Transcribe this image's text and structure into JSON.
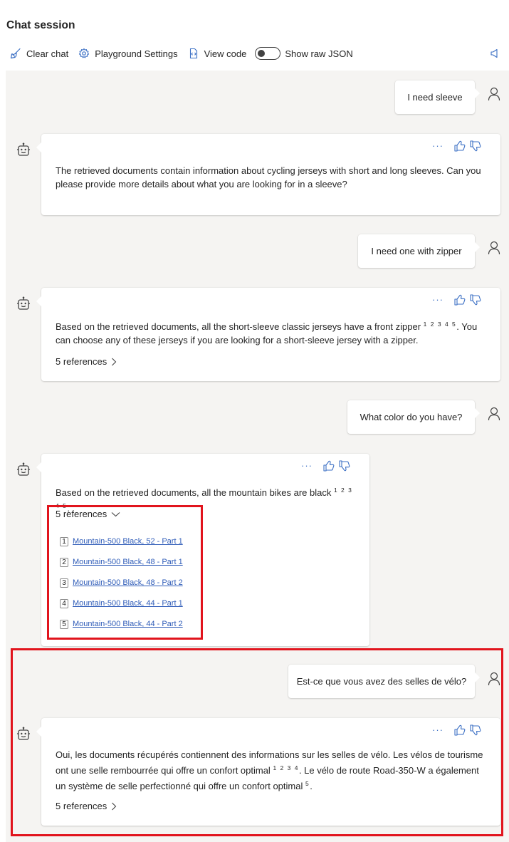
{
  "header": {
    "title": "Chat session"
  },
  "toolbar": {
    "clear_chat": "Clear chat",
    "playground_settings": "Playground Settings",
    "view_code": "View code",
    "show_raw_json": "Show raw JSON",
    "raw_json_enabled": false
  },
  "messages": [
    {
      "role": "user",
      "text": "I need sleeve"
    },
    {
      "role": "assistant",
      "text": "The retrieved documents contain information about cycling jerseys with short and long sleeves. Can you please provide more details about what you are looking for in a sleeve?"
    },
    {
      "role": "user",
      "text": "I need one with zipper"
    },
    {
      "role": "assistant",
      "text_a": "Based on the retrieved documents, all the short-sleeve classic jerseys have a front zipper",
      "cite": "1 2 3 4 5",
      "text_b": ". You can choose any of these jerseys if you are looking for a short-sleeve jersey with a zipper.",
      "references_label": "5 references"
    },
    {
      "role": "user",
      "text": "What color do you have?"
    },
    {
      "role": "assistant",
      "text_a": "Based on the retrieved documents, all the mountain bikes are black",
      "cite": "1 2 3 4 5",
      "text_b": ".",
      "references_label": "5 references",
      "references": [
        {
          "num": "1",
          "title": "Mountain-500 Black, 52 - Part 1"
        },
        {
          "num": "2",
          "title": "Mountain-500 Black, 48 - Part 1"
        },
        {
          "num": "3",
          "title": "Mountain-500 Black, 48 - Part 2"
        },
        {
          "num": "4",
          "title": "Mountain-500 Black, 44 - Part 1"
        },
        {
          "num": "5",
          "title": "Mountain-500 Black, 44 - Part 2"
        }
      ]
    },
    {
      "role": "user",
      "text": "Est-ce que vous avez des selles de vélo?"
    },
    {
      "role": "assistant",
      "text_a": "Oui, les documents récupérés contiennent des informations sur les selles de vélo. Les vélos de tourisme ont une selle rembourrée qui offre un confort optimal",
      "cite_a": "1 2 3 4",
      "text_b": ". Le vélo de route Road-350-W a également un système de selle perfectionné qui offre un confort optimal",
      "cite_b": "5",
      "text_c": ".",
      "references_label": "5 references"
    }
  ],
  "message_actions": {
    "more": "···"
  },
  "colors": {
    "highlight": "#e1141d",
    "chat_bg": "#f5f4f2",
    "link": "#2f5cb8"
  }
}
